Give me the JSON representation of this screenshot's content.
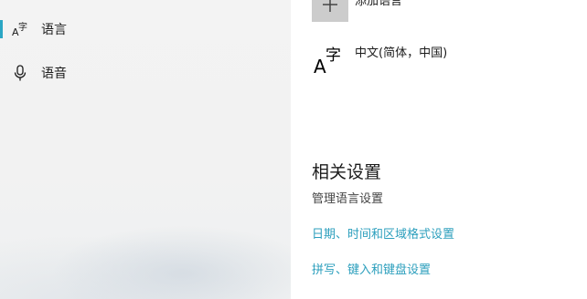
{
  "nav": {
    "items": [
      {
        "label": "语言",
        "icon": "language-icon",
        "selected": true
      },
      {
        "label": "语音",
        "icon": "microphone-icon",
        "selected": false
      }
    ]
  },
  "colors": {
    "accent": "#2ba6c4",
    "link": "#2c9fbd",
    "nav_background": "#f2f2f2",
    "tile": "#cccccc"
  },
  "content": {
    "add_language_label": "添加语言",
    "languages": [
      {
        "name": "中文(简体，中国)",
        "icon": "language-icon"
      }
    ],
    "related": {
      "title": "相关设置",
      "subtitle": "管理语言设置",
      "links": [
        "日期、时间和区域格式设置",
        "拼写、键入和键盘设置"
      ]
    }
  }
}
